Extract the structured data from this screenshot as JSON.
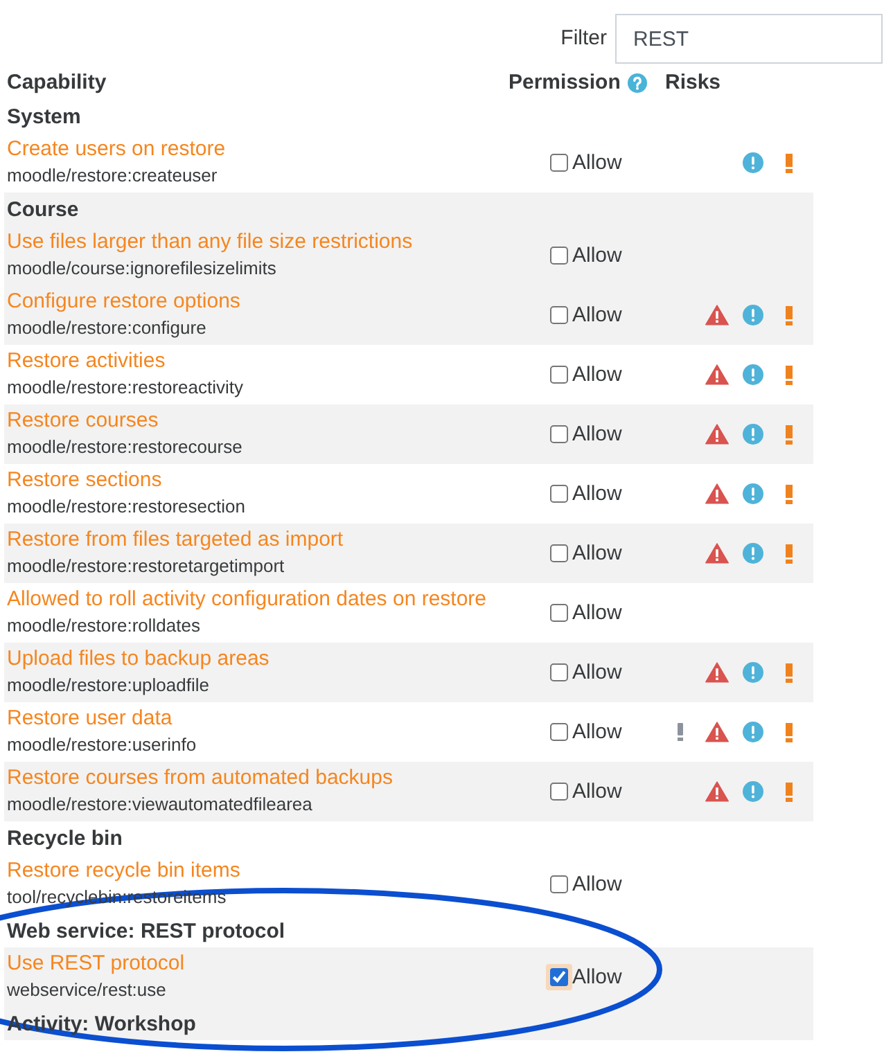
{
  "filter": {
    "label": "Filter",
    "value": "REST"
  },
  "table": {
    "columns": [
      {
        "label": "Capability"
      },
      {
        "label": "Permission",
        "help": true
      },
      {
        "label": "Risks"
      }
    ],
    "groups": [
      {
        "heading": "System",
        "shaded": false,
        "rows": [
          {
            "name": "Create users on restore",
            "capability": "moodle/restore:createuser",
            "permission": "Allow",
            "checked": false,
            "focused": false,
            "shaded": false,
            "risks": {
              "info": true,
              "alert": true
            }
          }
        ]
      },
      {
        "heading": "Course",
        "shaded": true,
        "rows": [
          {
            "name": "Use files larger than any file size restrictions",
            "capability": "moodle/course:ignorefilesizelimits",
            "permission": "Allow",
            "checked": false,
            "focused": false,
            "shaded": true
          },
          {
            "name": "Configure restore options",
            "capability": "moodle/restore:configure",
            "permission": "Allow",
            "checked": false,
            "focused": false,
            "shaded": true,
            "risks": {
              "warning": true,
              "info": true,
              "alert": true
            }
          },
          {
            "name": "Restore activities",
            "capability": "moodle/restore:restoreactivity",
            "permission": "Allow",
            "checked": false,
            "focused": false,
            "shaded": false,
            "risks": {
              "warning": true,
              "info": true,
              "alert": true
            }
          },
          {
            "name": "Restore courses",
            "capability": "moodle/restore:restorecourse",
            "permission": "Allow",
            "checked": false,
            "focused": false,
            "shaded": true,
            "risks": {
              "warning": true,
              "info": true,
              "alert": true
            }
          },
          {
            "name": "Restore sections",
            "capability": "moodle/restore:restoresection",
            "permission": "Allow",
            "checked": false,
            "focused": false,
            "shaded": false,
            "risks": {
              "warning": true,
              "info": true,
              "alert": true
            }
          },
          {
            "name": "Restore from files targeted as import",
            "capability": "moodle/restore:restoretargetimport",
            "permission": "Allow",
            "checked": false,
            "focused": false,
            "shaded": true,
            "risks": {
              "warning": true,
              "info": true,
              "alert": true
            }
          },
          {
            "name": "Allowed to roll activity configuration dates on restore",
            "capability": "moodle/restore:rolldates",
            "permission": "Allow",
            "checked": false,
            "focused": false,
            "shaded": false
          },
          {
            "name": "Upload files to backup areas",
            "capability": "moodle/restore:uploadfile",
            "permission": "Allow",
            "checked": false,
            "focused": false,
            "shaded": true,
            "risks": {
              "warning": true,
              "info": true,
              "alert": true
            }
          },
          {
            "name": "Restore user data",
            "capability": "moodle/restore:userinfo",
            "permission": "Allow",
            "checked": false,
            "focused": false,
            "shaded": false,
            "risks": {
              "mark": true,
              "warning": true,
              "info": true,
              "alert": true
            }
          },
          {
            "name": "Restore courses from automated backups",
            "capability": "moodle/restore:viewautomatedfilearea",
            "permission": "Allow",
            "checked": false,
            "focused": false,
            "shaded": true,
            "risks": {
              "warning": true,
              "info": true,
              "alert": true
            }
          }
        ]
      },
      {
        "heading": "Recycle bin",
        "shaded": false,
        "rows": [
          {
            "name": "Restore recycle bin items",
            "capability": "tool/recyclebin:restoreitems",
            "permission": "Allow",
            "checked": false,
            "focused": false,
            "shaded": false
          }
        ]
      },
      {
        "heading": "Web service: REST protocol",
        "shaded": false,
        "rows": [
          {
            "name": "Use REST protocol",
            "capability": "webservice/rest:use",
            "permission": "Allow",
            "checked": true,
            "focused": true,
            "shaded": true
          }
        ]
      },
      {
        "heading": "Activity: Workshop",
        "shaded": true
      }
    ]
  }
}
